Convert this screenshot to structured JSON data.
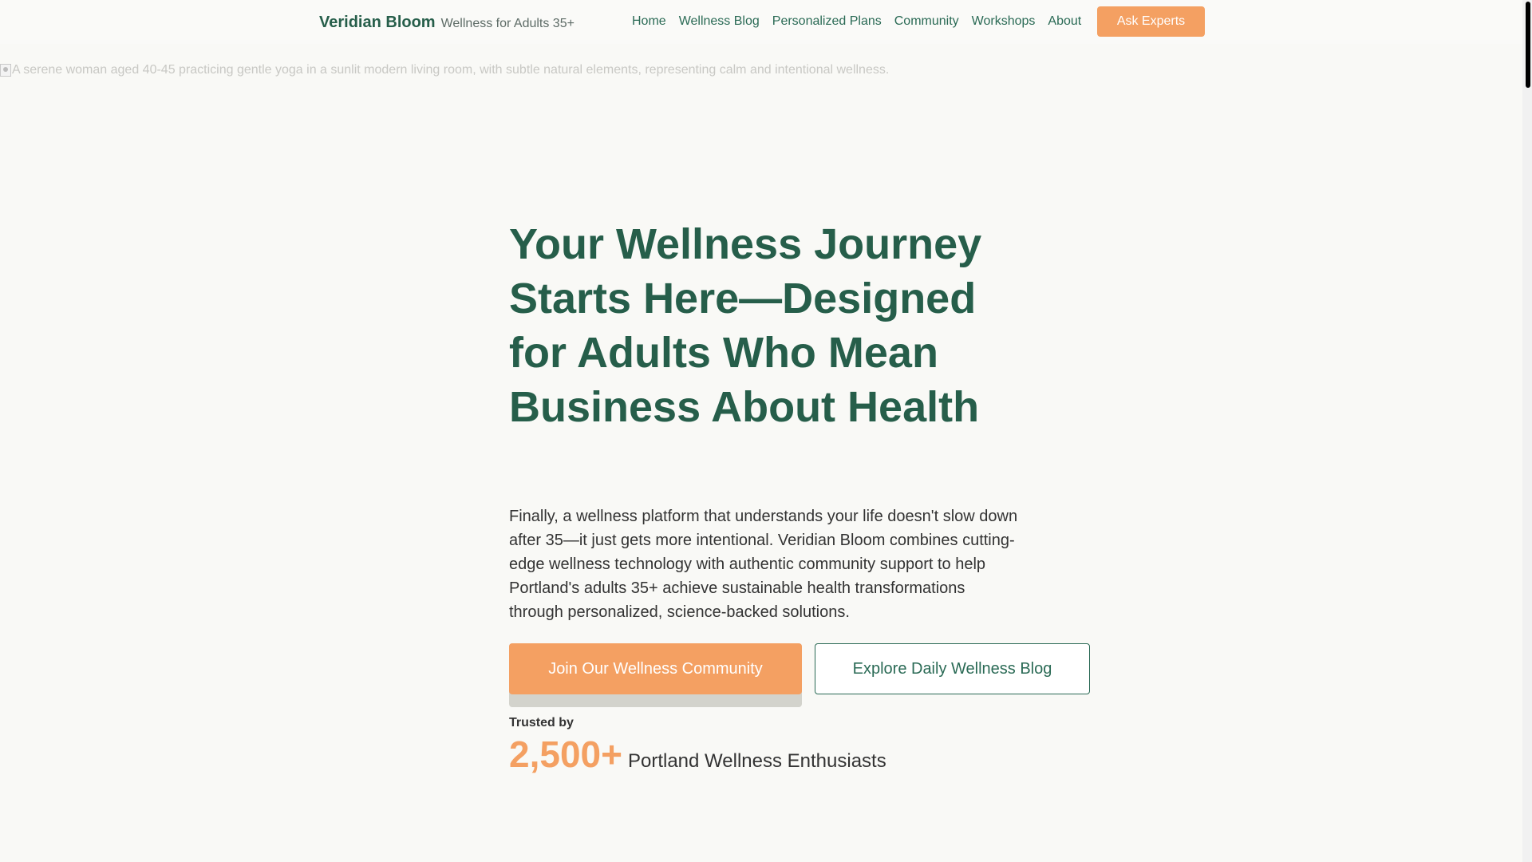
{
  "header": {
    "brand_name": "Veridian Bloom",
    "brand_tagline": "Wellness for Adults 35+",
    "nav": [
      {
        "label": "Home"
      },
      {
        "label": "Wellness Blog"
      },
      {
        "label": "Personalized Plans"
      },
      {
        "label": "Community"
      },
      {
        "label": "Workshops"
      },
      {
        "label": "About"
      }
    ],
    "cta_label": "Ask Experts"
  },
  "hero": {
    "image_alt": "A serene woman aged 40-45 practicing gentle yoga in a sunlit modern living room, with subtle natural elements, representing calm and intentional wellness.",
    "title": "Your Wellness Journey Starts Here—Designed for Adults Who Mean Business About Health",
    "description": "Finally, a wellness platform that understands your life doesn't slow down after 35—it just gets more intentional. Veridian Bloom combines cutting-edge wellness technology with authentic community support to help Portland's adults 35+ achieve sustainable health transformations through personalized, science-backed solutions.",
    "primary_cta": "Join Our Wellness Community",
    "secondary_cta": "Explore Daily Wellness Blog",
    "trusted_label": "Trusted by",
    "trusted_count": "2,500+",
    "trusted_caption": "Portland Wellness Enthusiasts"
  },
  "colors": {
    "brand_green": "#265e4a",
    "accent_orange": "#f4a062",
    "background": "#f9f9f6"
  }
}
